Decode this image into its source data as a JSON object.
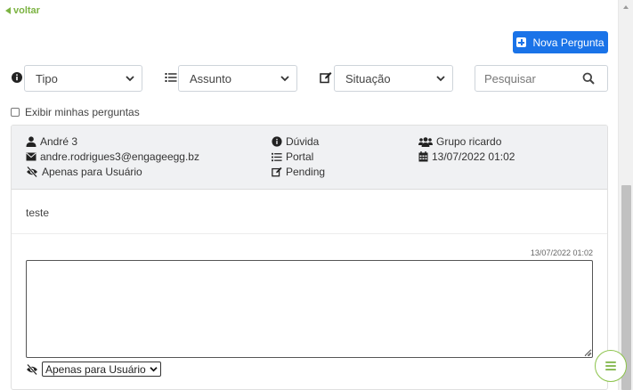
{
  "nav": {
    "back_label": "voltar"
  },
  "toolbar": {
    "new_question_label": "Nova Pergunta"
  },
  "filters": {
    "tipo": {
      "selected": "Tipo"
    },
    "assunto": {
      "selected": "Assunto"
    },
    "situacao": {
      "selected": "Situação"
    },
    "search_placeholder": "Pesquisar"
  },
  "mine_toggle": {
    "label": "Exibir minhas perguntas",
    "checked": false
  },
  "question": {
    "author": "André 3",
    "email": "andre.rodrigues3@engageegg.bz",
    "visibility": "Apenas para Usuário",
    "type": "Dúvida",
    "subject": "Portal",
    "status": "Pending",
    "group": "Grupo ricardo",
    "date": "13/07/2022 01:02",
    "message": "teste"
  },
  "reply": {
    "timestamp": "13/07/2022 01:02",
    "value": "",
    "visibility_selected": "Apenas para Usuário"
  },
  "colors": {
    "accent_green": "#7cb342",
    "primary_blue": "#1a73e8",
    "header_bg": "#f0f1f3"
  },
  "icons": {
    "back": "triangle-left-icon",
    "new": "plus-square-icon",
    "tipo": "info-circle-icon",
    "assunto": "list-icon",
    "situacao": "edit-icon",
    "search": "search-icon",
    "author": "user-icon",
    "email": "envelope-icon",
    "visibility": "eye-slash-icon",
    "group": "users-icon",
    "date": "calendar-icon",
    "menu": "hamburger-icon"
  }
}
